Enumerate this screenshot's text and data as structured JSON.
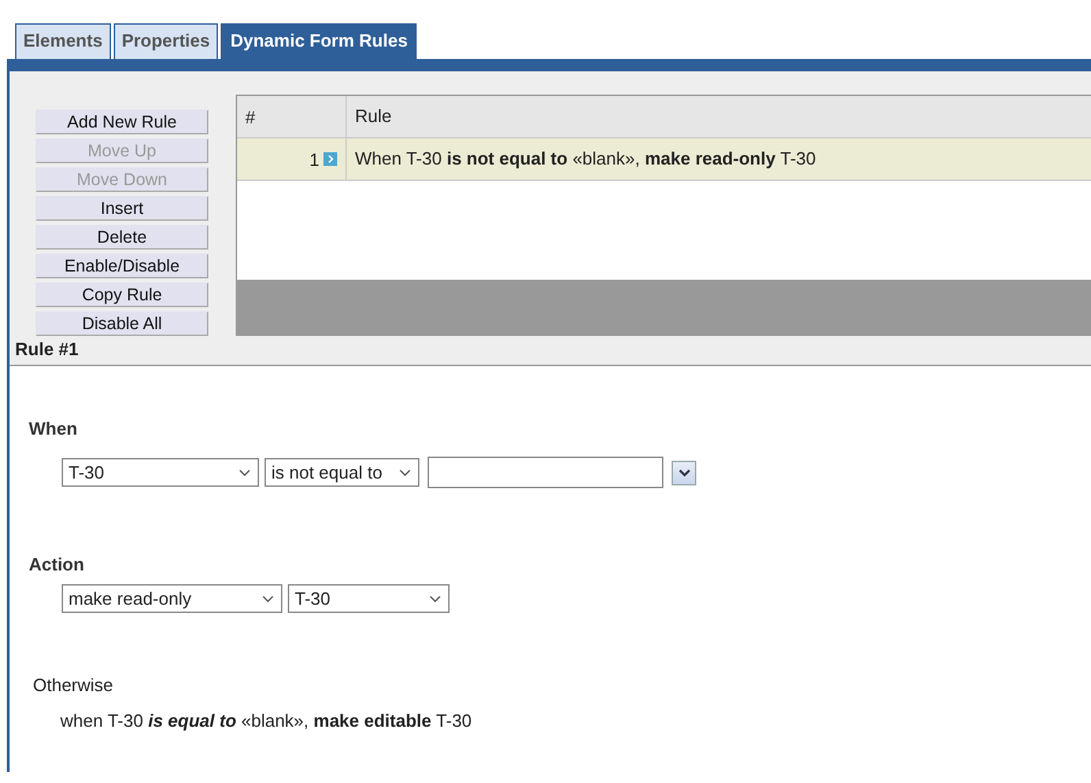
{
  "tabs": [
    {
      "label": "Elements",
      "selected": false
    },
    {
      "label": "Properties",
      "selected": false
    },
    {
      "label": "Dynamic Form Rules",
      "selected": true
    }
  ],
  "buttons": [
    {
      "label": "Add New Rule",
      "disabled": false
    },
    {
      "label": "Move Up",
      "disabled": true
    },
    {
      "label": "Move Down",
      "disabled": true
    },
    {
      "label": "Insert",
      "disabled": false
    },
    {
      "label": "Delete",
      "disabled": false
    },
    {
      "label": "Enable/Disable",
      "disabled": false
    },
    {
      "label": "Copy Rule",
      "disabled": false
    },
    {
      "label": "Disable All",
      "disabled": false
    }
  ],
  "table": {
    "columns": [
      "#",
      "Rule"
    ],
    "rows": [
      {
        "number": "1",
        "rule": "When T-30 **is not equal to** «blank», **make read-only** T-30",
        "selected": true
      }
    ]
  },
  "rule_title": "Rule #1",
  "when": {
    "heading": "When",
    "field": "T-30",
    "operator": "is not equal to"
  },
  "action": {
    "heading": "Action",
    "action": "make read-only",
    "target": "T-30"
  },
  "otherwise": {
    "heading": "Otherwise",
    "text": "when T-30 *is equal to* «blank», **make editable** T-30"
  }
}
